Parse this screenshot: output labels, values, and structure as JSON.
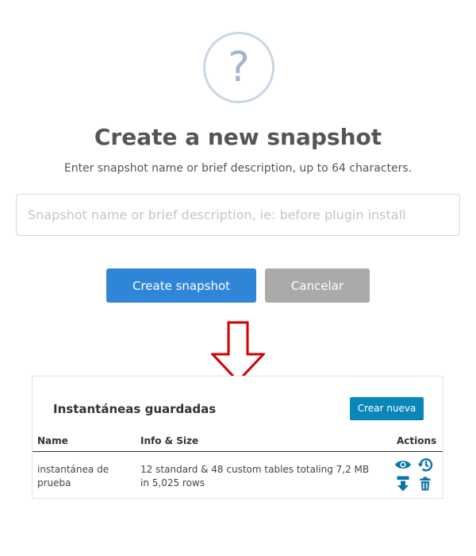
{
  "dialog": {
    "icon": "question-mark-icon",
    "icon_glyph": "?",
    "title": "Create a new snapshot",
    "subtitle": "Enter snapshot name or brief description, up to 64 characters.",
    "input_placeholder": "Snapshot name or brief description, ie: before plugin install",
    "input_value": "",
    "create_label": "Create snapshot",
    "cancel_label": "Cancelar"
  },
  "arrow": {
    "icon": "down-arrow-icon",
    "color": "#d40000"
  },
  "panel": {
    "title": "Instantáneas guardadas",
    "new_label": "Crear nueva",
    "columns": {
      "name": "Name",
      "info": "Info & Size",
      "actions": "Actions"
    },
    "rows": [
      {
        "name": "instantánea de prueba",
        "info": "12 standard & 48 custom tables totaling 7,2 MB in 5,025 rows",
        "actions": [
          "view-icon",
          "restore-icon",
          "download-icon",
          "delete-icon"
        ]
      }
    ]
  },
  "colors": {
    "primary": "#2f86d9",
    "cancel": "#aaaaaa",
    "new_button": "#0a87b9",
    "action_icons": "#0a73a8",
    "arrow": "#d40000"
  }
}
